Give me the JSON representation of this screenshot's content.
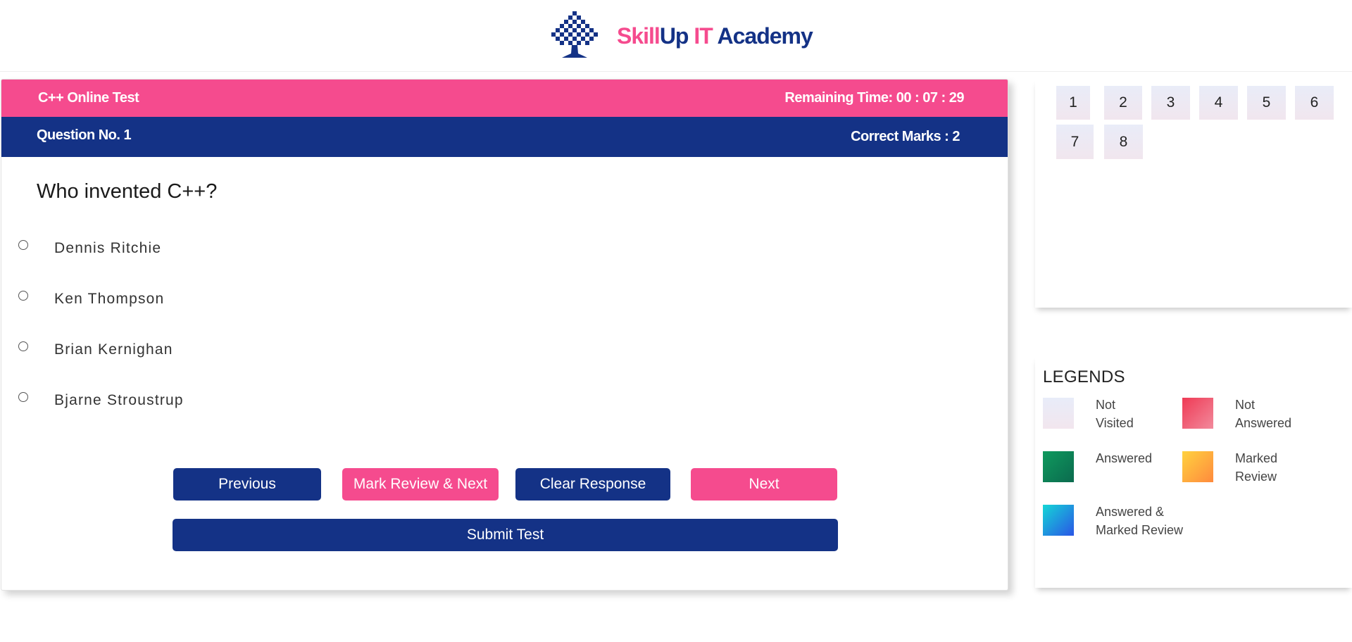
{
  "header": {
    "brand_part1": "Skill",
    "brand_part2": "Up",
    "brand_part3": "IT",
    "brand_part4": "Academy"
  },
  "test": {
    "title": "C++ Online Test",
    "remaining_time": "Remaining Time: 00 : 07 : 29",
    "question_no": "Question No. 1",
    "correct_marks": "Correct Marks : 2",
    "question": "Who invented C++?",
    "options": [
      "Dennis Ritchie",
      "Ken Thompson",
      "Brian Kernighan",
      "Bjarne Stroustrup"
    ]
  },
  "buttons": {
    "previous": "Previous",
    "mark_review_next": "Mark Review & Next",
    "clear_response": "Clear Response",
    "next": "Next",
    "submit": "Submit Test"
  },
  "question_numbers": [
    "1",
    "2",
    "3",
    "4",
    "5",
    "6",
    "7",
    "8"
  ],
  "legends": {
    "title": "LEGENDS",
    "not_visited": [
      "Not",
      "Visited"
    ],
    "not_answered": [
      "Not",
      "Answered"
    ],
    "answered": "Answered",
    "marked_review": [
      "Marked",
      "Review"
    ],
    "answered_marked": [
      "Answered &",
      "Marked Review"
    ]
  },
  "colors": {
    "pink": "#f54b8e",
    "navy": "#143286"
  }
}
